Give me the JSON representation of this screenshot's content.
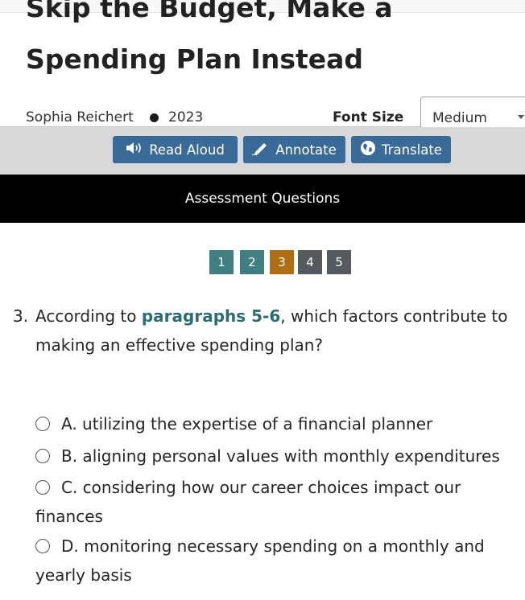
{
  "article": {
    "title_line1": "Skip the Budget, Make a",
    "title_line2": "Spending Plan Instead",
    "author": "Sophia Reichert",
    "year": "2023"
  },
  "font_size": {
    "label": "Font Size",
    "value": "Medium"
  },
  "toolbar": {
    "read_aloud": "Read Aloud",
    "annotate": "Annotate",
    "translate": "Translate"
  },
  "assessment": {
    "title": "Assessment Questions",
    "question_numbers": [
      "1",
      "2",
      "3",
      "4",
      "5"
    ],
    "current": "3"
  },
  "question": {
    "number": "3.",
    "text_before": "According to ",
    "text_bold": "paragraphs 5-6",
    "text_after": ", which factors contribute to making an effective spending plan?"
  },
  "choices": [
    {
      "text": "A. utilizing the expertise of a financial planner",
      "cont": ""
    },
    {
      "text": "B. aligning personal values with monthly expenditures",
      "cont": ""
    },
    {
      "text": "C. considering how our career choices impact our",
      "cont": "finances"
    },
    {
      "text": "D. monitoring necessary spending on a monthly and",
      "cont": "yearly basis"
    }
  ],
  "colors": {
    "toolbar_button": "#3a6a97",
    "question_teal": "#3f7f82",
    "question_active": "#b06d12",
    "question_gray": "#555a60",
    "bold_text": "#2d6c74"
  }
}
